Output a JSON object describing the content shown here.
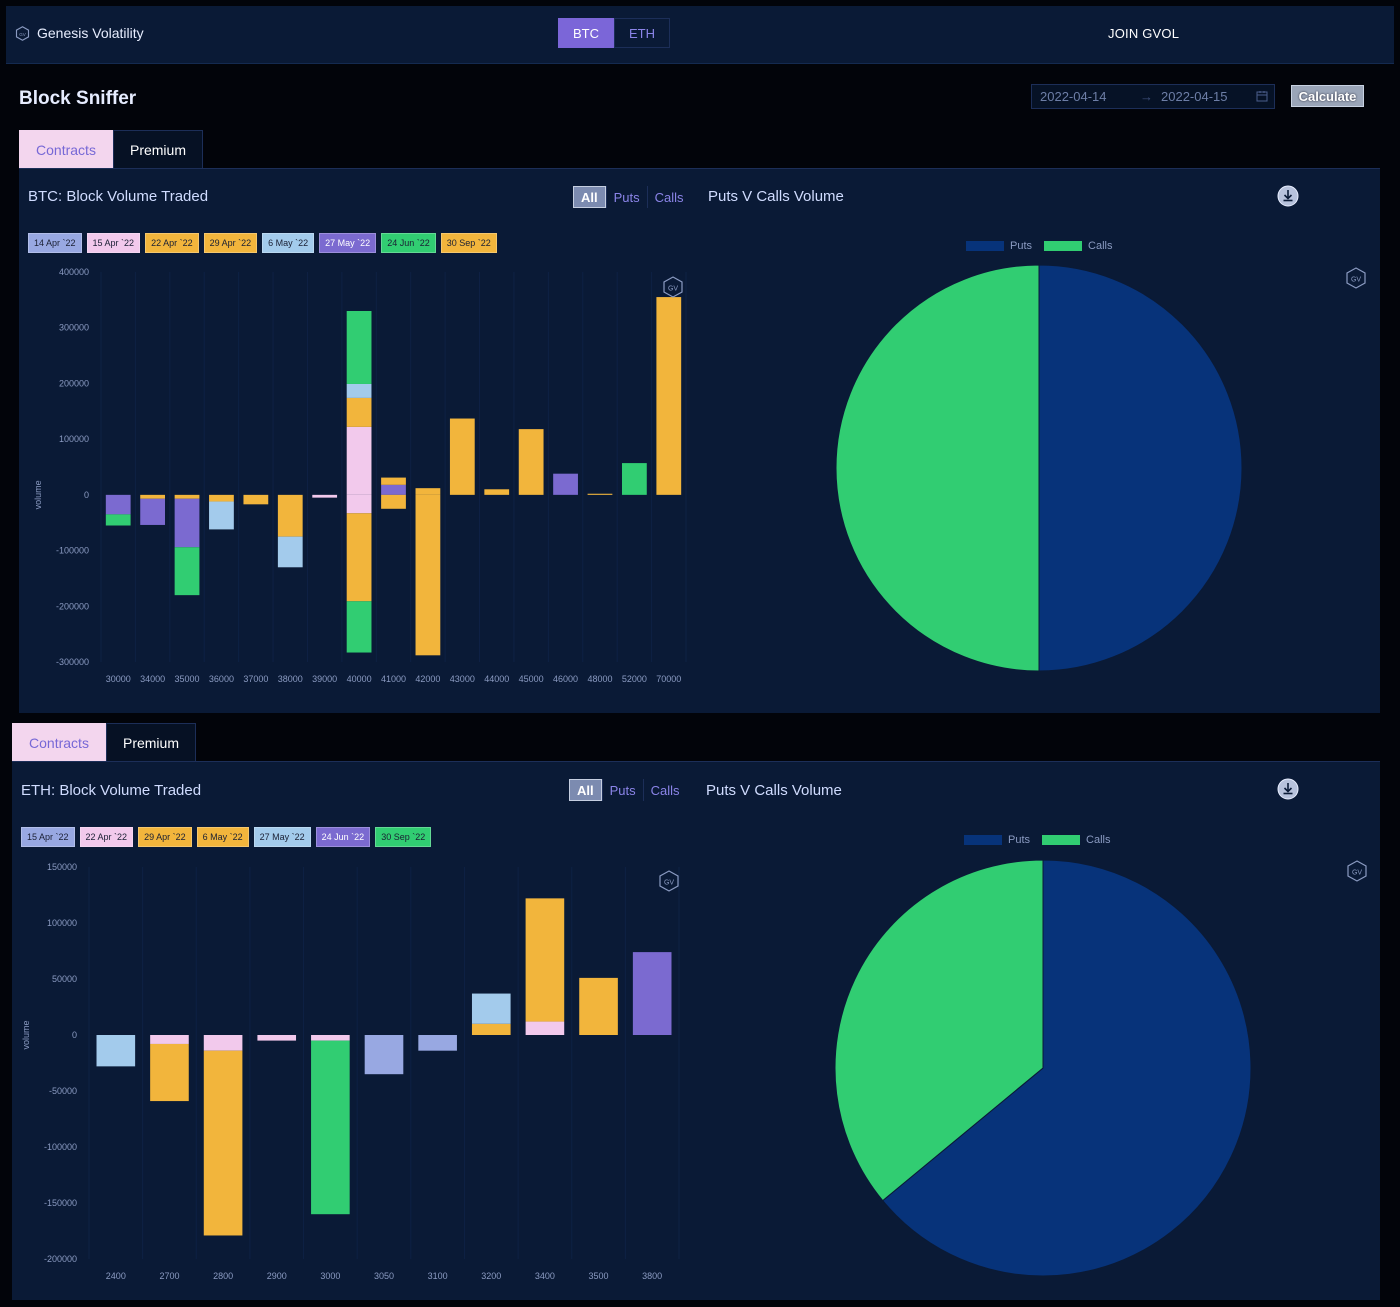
{
  "app": {
    "brand": "Genesis Volatility",
    "join_label": "JOIN GVOL"
  },
  "assets": [
    {
      "label": "BTC",
      "active": true
    },
    {
      "label": "ETH",
      "active": false
    }
  ],
  "page": {
    "title": "Block Sniffer"
  },
  "date_range": {
    "start": "2022-04-14",
    "separator": "→",
    "end": "2022-04-15"
  },
  "calculate_label": "Calculate",
  "view_tabs": {
    "contracts": "Contracts",
    "premium": "Premium"
  },
  "filters": {
    "all": "All",
    "puts": "Puts",
    "calls": "Calls"
  },
  "pie_title": "Puts V Calls Volume",
  "pie_legend": {
    "puts": "Puts",
    "calls": "Calls"
  },
  "badge": "GV",
  "colors": {
    "puts": "#07337a",
    "calls": "#31cd72",
    "accent": "#7b66d8",
    "background": "#0a1a36"
  },
  "btc": {
    "title": "BTC: Block Volume Traded",
    "expiries": [
      {
        "label": "14 Apr `22",
        "color": "#98a8e2"
      },
      {
        "label": "15 Apr `22",
        "color": "#f2c9ec"
      },
      {
        "label": "22 Apr `22",
        "color": "#f2b53c"
      },
      {
        "label": "29 Apr `22",
        "color": "#f2b53c"
      },
      {
        "label": "6 May `22",
        "color": "#a3cbec"
      },
      {
        "label": "27 May `22",
        "color": "#7b6ad0"
      },
      {
        "label": "24 Jun `22",
        "color": "#31cd72"
      },
      {
        "label": "30 Sep `22",
        "color": "#f2b53c"
      }
    ]
  },
  "eth": {
    "title": "ETH: Block Volume Traded",
    "expiries": [
      {
        "label": "15 Apr `22",
        "color": "#98a8e2"
      },
      {
        "label": "22 Apr `22",
        "color": "#f2c9ec"
      },
      {
        "label": "29 Apr `22",
        "color": "#f2b53c"
      },
      {
        "label": "6 May `22",
        "color": "#f2b53c"
      },
      {
        "label": "27 May `22",
        "color": "#a3cbec"
      },
      {
        "label": "24 Jun `22",
        "color": "#7b6ad0"
      },
      {
        "label": "30 Sep `22",
        "color": "#31cd72"
      }
    ]
  },
  "chart_data": [
    {
      "type": "bar",
      "title": "BTC: Block Volume Traded",
      "ylabel": "volume",
      "ylim": [
        -300000,
        400000
      ],
      "yticks": [
        "400000",
        "300000",
        "200000",
        "100000",
        "0",
        "-100000",
        "-200000",
        "-300000"
      ],
      "categories": [
        "30000",
        "34000",
        "35000",
        "36000",
        "37000",
        "38000",
        "39000",
        "40000",
        "41000",
        "42000",
        "43000",
        "44000",
        "45000",
        "46000",
        "48000",
        "52000",
        "70000"
      ],
      "stacks": [
        {
          "x": "30000",
          "segments": [
            {
              "v": -35000,
              "c": "#7b6ad0"
            },
            {
              "v": -20000,
              "c": "#31cd72"
            }
          ]
        },
        {
          "x": "34000",
          "segments": [
            {
              "v": -7000,
              "c": "#f2b53c"
            },
            {
              "v": -47000,
              "c": "#7b6ad0"
            }
          ]
        },
        {
          "x": "35000",
          "segments": [
            {
              "v": -7000,
              "c": "#f2b53c"
            },
            {
              "v": -87000,
              "c": "#7b6ad0"
            },
            {
              "v": -86000,
              "c": "#31cd72"
            }
          ]
        },
        {
          "x": "36000",
          "segments": [
            {
              "v": -12000,
              "c": "#f2b53c"
            },
            {
              "v": -50000,
              "c": "#a3cbec"
            }
          ]
        },
        {
          "x": "37000",
          "segments": [
            {
              "v": -17000,
              "c": "#f2b53c"
            }
          ]
        },
        {
          "x": "38000",
          "segments": [
            {
              "v": -75000,
              "c": "#f2b53c"
            },
            {
              "v": -55000,
              "c": "#a3cbec"
            }
          ]
        },
        {
          "x": "39000",
          "segments": [
            {
              "v": -5000,
              "c": "#f2c9ec"
            }
          ]
        },
        {
          "x": "40000",
          "segments": [
            {
              "v": 122000,
              "c": "#f2c9ec"
            },
            {
              "v": 52000,
              "c": "#f2b53c"
            },
            {
              "v": 25000,
              "c": "#a3cbec"
            },
            {
              "v": 131000,
              "c": "#31cd72"
            },
            {
              "v": -33000,
              "c": "#f2c9ec"
            },
            {
              "v": -158000,
              "c": "#f2b53c"
            },
            {
              "v": -92000,
              "c": "#31cd72"
            }
          ]
        },
        {
          "x": "41000",
          "segments": [
            {
              "v": 18000,
              "c": "#7b6ad0"
            },
            {
              "v": 13000,
              "c": "#f2b53c"
            },
            {
              "v": -25000,
              "c": "#f2b53c"
            }
          ]
        },
        {
          "x": "42000",
          "segments": [
            {
              "v": 12000,
              "c": "#f2b53c"
            },
            {
              "v": -288000,
              "c": "#f2b53c"
            }
          ]
        },
        {
          "x": "43000",
          "segments": [
            {
              "v": 137000,
              "c": "#f2b53c"
            }
          ]
        },
        {
          "x": "44000",
          "segments": [
            {
              "v": 10000,
              "c": "#f2b53c"
            }
          ]
        },
        {
          "x": "45000",
          "segments": [
            {
              "v": 118000,
              "c": "#f2b53c"
            }
          ]
        },
        {
          "x": "46000",
          "segments": [
            {
              "v": 38000,
              "c": "#7b6ad0"
            }
          ]
        },
        {
          "x": "48000",
          "segments": [
            {
              "v": 2000,
              "c": "#f2b53c"
            }
          ]
        },
        {
          "x": "52000",
          "segments": [
            {
              "v": 57000,
              "c": "#31cd72"
            }
          ]
        },
        {
          "x": "70000",
          "segments": [
            {
              "v": 355000,
              "c": "#f2b53c"
            }
          ]
        }
      ]
    },
    {
      "type": "pie",
      "title": "Puts V Calls Volume",
      "slices": [
        {
          "name": "Puts",
          "value": 50,
          "color": "#07337a"
        },
        {
          "name": "Calls",
          "value": 50,
          "color": "#31cd72"
        }
      ]
    },
    {
      "type": "bar",
      "title": "ETH: Block Volume Traded",
      "ylabel": "volume",
      "ylim": [
        -200000,
        150000
      ],
      "yticks": [
        "150000",
        "100000",
        "50000",
        "0",
        "-50000",
        "-100000",
        "-150000",
        "-200000"
      ],
      "categories": [
        "2400",
        "2700",
        "2800",
        "2900",
        "3000",
        "3050",
        "3100",
        "3200",
        "3400",
        "3500",
        "3800"
      ],
      "stacks": [
        {
          "x": "2400",
          "segments": [
            {
              "v": -28000,
              "c": "#a3cbec"
            }
          ]
        },
        {
          "x": "2700",
          "segments": [
            {
              "v": -8000,
              "c": "#f2c9ec"
            },
            {
              "v": -51000,
              "c": "#f2b53c"
            }
          ]
        },
        {
          "x": "2800",
          "segments": [
            {
              "v": -14000,
              "c": "#f2c9ec"
            },
            {
              "v": -165000,
              "c": "#f2b53c"
            }
          ]
        },
        {
          "x": "2900",
          "segments": [
            {
              "v": -5000,
              "c": "#f2c9ec"
            }
          ]
        },
        {
          "x": "3000",
          "segments": [
            {
              "v": -5000,
              "c": "#f2c9ec"
            },
            {
              "v": -155000,
              "c": "#31cd72"
            }
          ]
        },
        {
          "x": "3050",
          "segments": [
            {
              "v": -35000,
              "c": "#98a8e2"
            }
          ]
        },
        {
          "x": "3100",
          "segments": [
            {
              "v": -14000,
              "c": "#98a8e2"
            }
          ]
        },
        {
          "x": "3200",
          "segments": [
            {
              "v": 10000,
              "c": "#f2b53c"
            },
            {
              "v": 27000,
              "c": "#a3cbec"
            }
          ]
        },
        {
          "x": "3400",
          "segments": [
            {
              "v": 12000,
              "c": "#f2c9ec"
            },
            {
              "v": 110000,
              "c": "#f2b53c"
            }
          ]
        },
        {
          "x": "3500",
          "segments": [
            {
              "v": 51000,
              "c": "#f2b53c"
            }
          ]
        },
        {
          "x": "3800",
          "segments": [
            {
              "v": 74000,
              "c": "#7b6ad0"
            }
          ]
        }
      ]
    },
    {
      "type": "pie",
      "title": "Puts V Calls Volume",
      "slices": [
        {
          "name": "Puts",
          "value": 64,
          "color": "#07337a"
        },
        {
          "name": "Calls",
          "value": 36,
          "color": "#31cd72"
        }
      ]
    }
  ]
}
